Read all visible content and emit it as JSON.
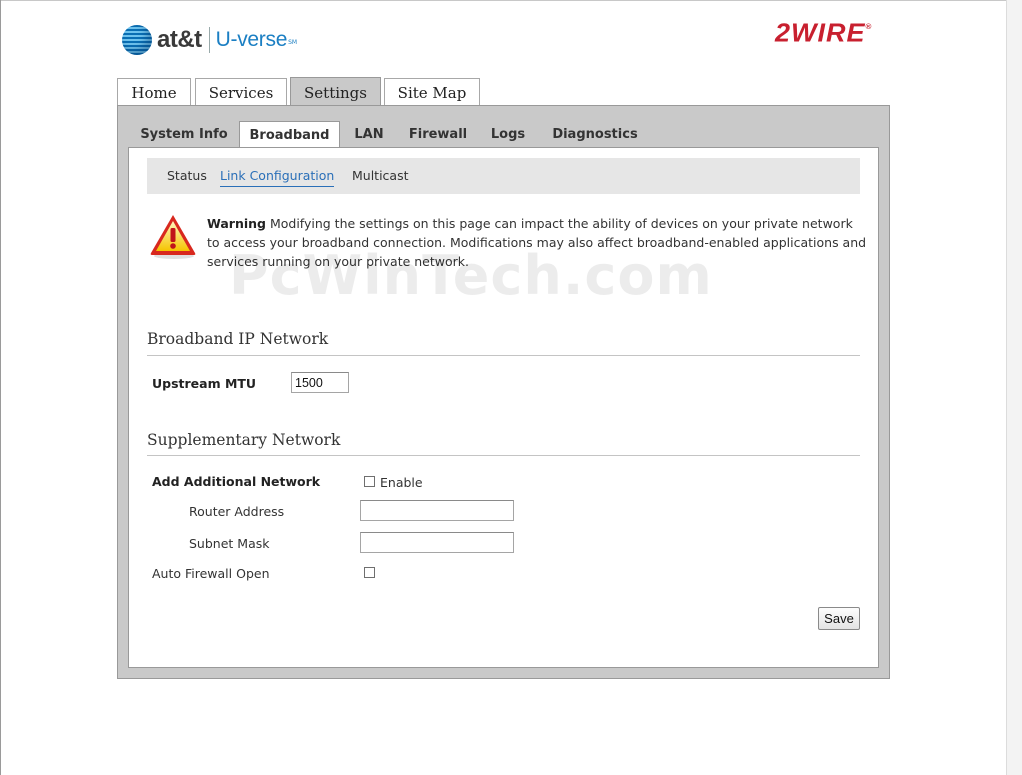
{
  "header": {
    "brand": "at&t",
    "product": "U-verse",
    "product_mark": "SM",
    "vendor": "2WIRE",
    "vendor_mark": "®"
  },
  "main_tabs": [
    {
      "label": "Home"
    },
    {
      "label": "Services"
    },
    {
      "label": "Settings",
      "active": true
    },
    {
      "label": "Site Map"
    }
  ],
  "sub_tabs": [
    {
      "label": "System Info"
    },
    {
      "label": "Broadband",
      "active": true
    },
    {
      "label": "LAN"
    },
    {
      "label": "Firewall"
    },
    {
      "label": "Logs"
    },
    {
      "label": "Diagnostics"
    }
  ],
  "subnav": [
    {
      "label": "Status"
    },
    {
      "label": "Link Configuration",
      "active": true
    },
    {
      "label": "Multicast"
    }
  ],
  "warning": {
    "title": "Warning",
    "text": " Modifying the settings on this page can impact the ability of devices on your private network to access your broadband connection. Modifications may also affect broadband-enabled applications and services running on your private network."
  },
  "watermark": "PcWinTech.com",
  "broadband_ip": {
    "title": "Broadband IP Network",
    "upstream_mtu_label": "Upstream MTU",
    "upstream_mtu_value": "1500"
  },
  "supplementary": {
    "title": "Supplementary Network",
    "add_network_label": "Add Additional Network",
    "enable_label": "Enable",
    "enable_checked": false,
    "router_address_label": "Router Address",
    "router_address_value": "",
    "subnet_mask_label": "Subnet Mask",
    "subnet_mask_value": "",
    "auto_firewall_label": "Auto Firewall Open",
    "auto_firewall_checked": false
  },
  "actions": {
    "save_label": "Save"
  },
  "colors": {
    "brand_blue": "#1b7fc3",
    "vendor_red": "#c8202f",
    "link_active": "#2a6fb8",
    "panel_gray": "#c9c9c9"
  }
}
